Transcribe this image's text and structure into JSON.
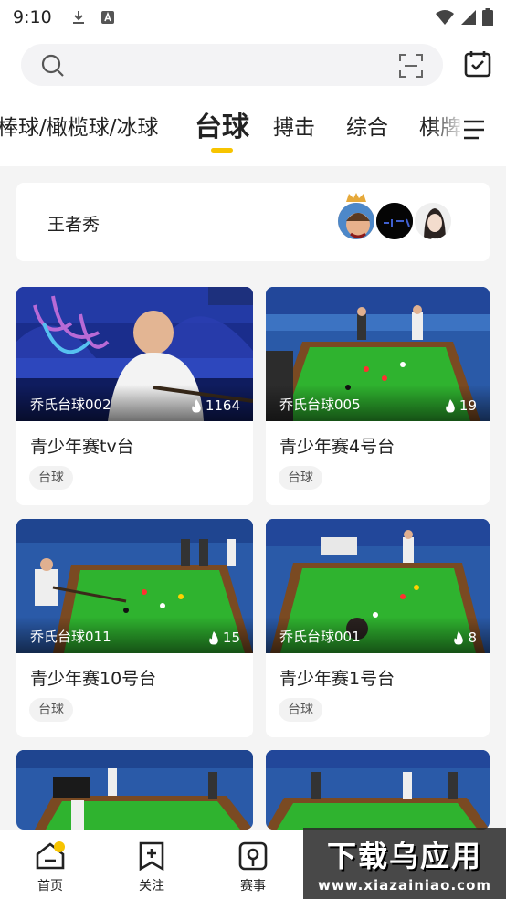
{
  "status_bar": {
    "time": "9:10"
  },
  "tabs": {
    "items": [
      "棒球/橄榄球/冰球",
      "台球",
      "搏击",
      "综合",
      "棋牌"
    ],
    "active": "台球"
  },
  "king_section": {
    "title": "王者秀"
  },
  "videos": [
    {
      "streamer": "乔氏台球002",
      "viewers": "1164",
      "title": "青少年赛tv台",
      "tag": "台球"
    },
    {
      "streamer": "乔氏台球005",
      "viewers": "19",
      "title": "青少年赛4号台",
      "tag": "台球"
    },
    {
      "streamer": "乔氏台球011",
      "viewers": "15",
      "title": "青少年赛10号台",
      "tag": "台球"
    },
    {
      "streamer": "乔氏台球001",
      "viewers": "8",
      "title": "青少年赛1号台",
      "tag": "台球"
    }
  ],
  "bottom_nav": {
    "items": [
      "首页",
      "关注",
      "赛事"
    ]
  },
  "watermark": {
    "main": "下载乌应用",
    "sub": "www.xiazainiao.com"
  },
  "colors": {
    "accent": "#f7c400",
    "table_green": "#2fae2f",
    "arena_blue": "#1f55a8"
  }
}
